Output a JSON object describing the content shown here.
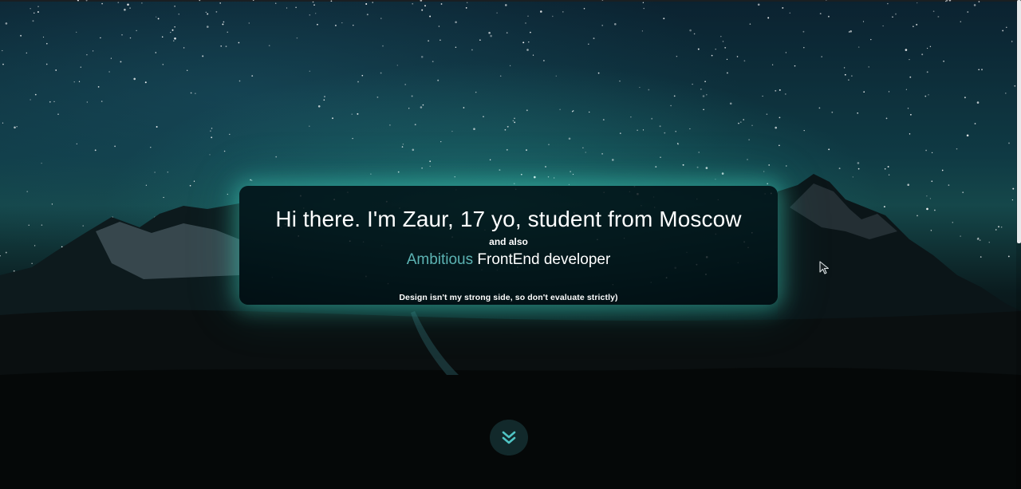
{
  "hero": {
    "headline": "Hi there. I'm Zaur, 17 yo, student from Moscow",
    "and_also": "and also",
    "role_accent": "Ambitious",
    "role_rest": " FrontEnd developer",
    "note": "Design isn't my strong side, so don't evaluate strictly)"
  },
  "scroll_button": {
    "icon": "chevron-double-down-icon"
  },
  "colors": {
    "accent": "#5cb3b3",
    "glow": "#40d2be",
    "text": "#ffffff"
  }
}
